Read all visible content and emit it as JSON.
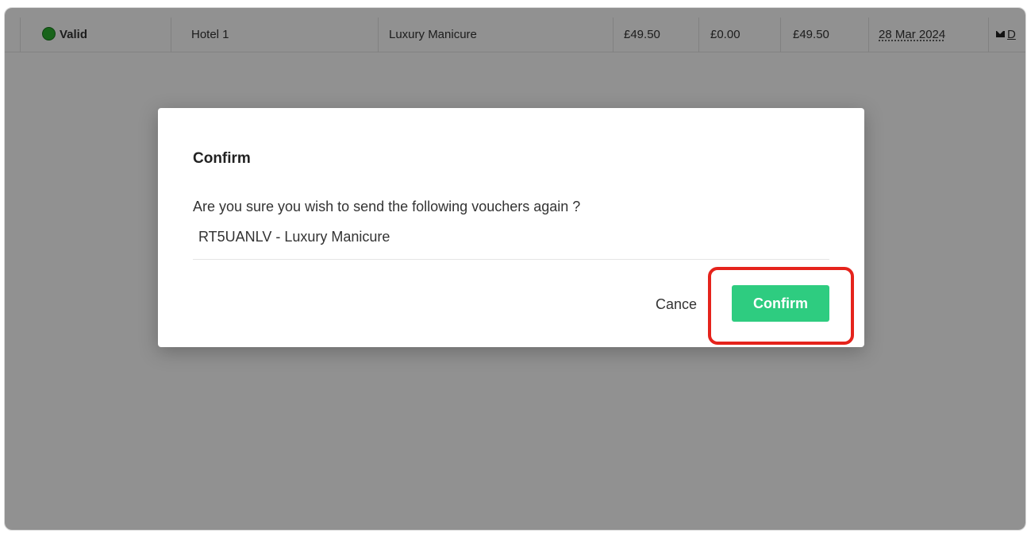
{
  "voucher_row": {
    "status": "Valid",
    "status_color": "#2bb02f",
    "hotel": "Hotel 1",
    "product": "Luxury Manicure",
    "price": "£49.50",
    "discount": "£0.00",
    "total": "£49.50",
    "date": "28 Mar 2024",
    "action_link": "D"
  },
  "dialog": {
    "title": "Confirm",
    "message": "Are you sure you wish to send the following vouchers again ?",
    "item": "RT5UANLV - Luxury Manicure",
    "cancel_label": "Cance",
    "confirm_label": "Confirm",
    "confirm_color": "#2ecc80",
    "highlight_color": "#e5231c"
  }
}
